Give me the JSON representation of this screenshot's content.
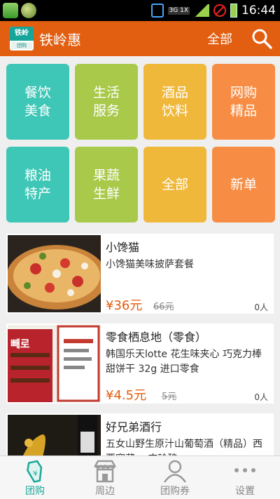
{
  "status_bar": {
    "time": "16:44",
    "network_badge": "3G 1X"
  },
  "app_bar": {
    "logo_text": "铁岭",
    "logo_subtext": "团购",
    "title": "铁岭惠",
    "all_label": "全部",
    "search_icon": "search-icon"
  },
  "categories": [
    {
      "label": "餐饮\n美食",
      "color": "#3ec6b6"
    },
    {
      "label": "生活\n服务",
      "color": "#a9c94a"
    },
    {
      "label": "酒品\n饮料",
      "color": "#f0b83a"
    },
    {
      "label": "网购\n精品",
      "color": "#f78d45"
    },
    {
      "label": "粮油\n特产",
      "color": "#3ec6b6"
    },
    {
      "label": "果蔬\n生鲜",
      "color": "#a9c94a"
    },
    {
      "label": "全部",
      "color": "#f0b83a"
    },
    {
      "label": "新单",
      "color": "#f78d45"
    }
  ],
  "deals": [
    {
      "name": "小馋猫",
      "desc": "小馋猫美味披萨套餐",
      "price": "¥36元",
      "orig": "66元",
      "count": "0人"
    },
    {
      "name": "零食栖息地（零食）",
      "desc": "韩国乐天lotte 花生味夹心 巧克力棒甜饼干 32g 进口零食",
      "price": "¥4.5元",
      "orig": "5元",
      "count": "0人",
      "image_text": "빼로"
    },
    {
      "name": "好兄弟酒行",
      "desc": "五女山野生原汁山葡萄酒（精品）西要窖藏 一支珍酿",
      "price": "",
      "orig": "",
      "count": ""
    }
  ],
  "tabs": [
    {
      "label": "团购",
      "icon": "tag-icon",
      "active": true
    },
    {
      "label": "周边",
      "icon": "shop-icon",
      "active": false
    },
    {
      "label": "团购券",
      "icon": "user-icon",
      "active": false
    },
    {
      "label": "设置",
      "icon": "more-icon",
      "active": false
    }
  ],
  "colors": {
    "accent": "#e25e10",
    "price": "#e45c0f",
    "active_tab": "#1ba89a"
  }
}
